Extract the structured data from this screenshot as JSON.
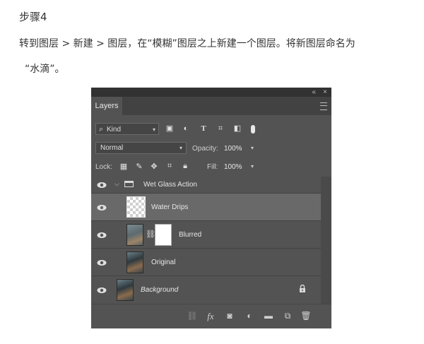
{
  "tutorial": {
    "step": "步骤4",
    "line1": "转到图层 > 新建 > 图层，在“模糊”图层之上新建一个图层。将新图层命名为",
    "line2": "“水滴”。"
  },
  "panel": {
    "controls": {
      "collapse": "«",
      "close": "×"
    },
    "tab_label": "Layers",
    "filter": {
      "kind_label": "Kind",
      "icons": [
        "image-filter-icon",
        "adjustment-filter-icon",
        "type-filter-icon",
        "shape-filter-icon",
        "smart-object-filter-icon",
        "filter-toggle-icon"
      ]
    },
    "blend_mode": "Normal",
    "opacity_label": "Opacity:",
    "opacity_value": "100%",
    "lock_label": "Lock:",
    "fill_label": "Fill:",
    "fill_value": "100%",
    "layers": [
      {
        "name": "Wet Glass Action",
        "type": "group",
        "selected": false
      },
      {
        "name": "Water Drips",
        "type": "transparent",
        "selected": true
      },
      {
        "name": "Blurred",
        "type": "masked",
        "selected": false
      },
      {
        "name": "Original",
        "type": "photo",
        "selected": false
      },
      {
        "name": "Background",
        "type": "background",
        "selected": false
      }
    ],
    "bottom_icons": [
      "link-icon",
      "fx-icon",
      "mask-icon",
      "adjustment-icon",
      "folder-icon",
      "new-layer-icon",
      "trash-icon"
    ],
    "fx_label": "fx"
  }
}
